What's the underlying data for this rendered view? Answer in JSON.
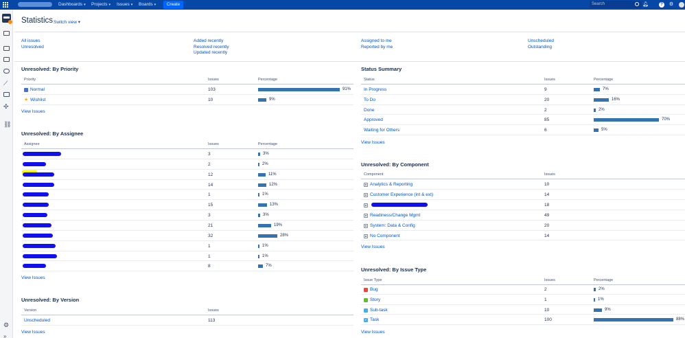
{
  "topbar": {
    "nav": [
      {
        "label": "Dashboards"
      },
      {
        "label": "Projects"
      },
      {
        "label": "Issues"
      },
      {
        "label": "Boards"
      }
    ],
    "create_label": "Create",
    "search_placeholder": "Search",
    "icons": [
      "app-switcher-icon",
      "search-icon",
      "notifications-icon",
      "help-icon",
      "settings-icon",
      "avatar"
    ]
  },
  "sidebar": {
    "icons": [
      "project-avatar",
      "backlog-icon",
      "board-icon",
      "releases-icon",
      "reports-icon",
      "issues-icon",
      "components-icon",
      "addons-icon",
      "link-icon",
      "settings-icon",
      "collapse-icon"
    ]
  },
  "page": {
    "title": "Statistics",
    "switch_view": "Switch view"
  },
  "filters": {
    "col1": [
      "All issues",
      "Unresolved"
    ],
    "col2": [
      "Added recently",
      "Resolved recently",
      "Updated recently"
    ],
    "col3": [
      "Assigned to me",
      "Reported by me"
    ],
    "col4": [
      "Unscheduled",
      "Outstanding"
    ]
  },
  "by_priority": {
    "title": "Unresolved: By Priority",
    "headers": {
      "name": "Priority",
      "issues": "Issues",
      "pct": "Percentage"
    },
    "rows": [
      {
        "name": "Normal",
        "issues": "103",
        "pct": "91%",
        "fraction": 0.91,
        "icon": "normal-priority-icon"
      },
      {
        "name": "Wishlist",
        "issues": "10",
        "pct": "9%",
        "fraction": 0.09,
        "icon": "wishlist-priority-icon"
      }
    ],
    "view": "View Issues"
  },
  "by_assignee": {
    "title": "Unresolved: By Assignee",
    "headers": {
      "name": "Assignee",
      "issues": "Issues",
      "pct": "Percentage"
    },
    "rows": [
      {
        "issues": "3",
        "pct": "3%",
        "fraction": 0.03
      },
      {
        "issues": "2",
        "pct": "2%",
        "fraction": 0.02
      },
      {
        "issues": "12",
        "pct": "11%",
        "fraction": 0.11
      },
      {
        "issues": "14",
        "pct": "12%",
        "fraction": 0.12
      },
      {
        "issues": "1",
        "pct": "1%",
        "fraction": 0.01
      },
      {
        "issues": "15",
        "pct": "13%",
        "fraction": 0.13
      },
      {
        "issues": "3",
        "pct": "3%",
        "fraction": 0.03
      },
      {
        "issues": "21",
        "pct": "19%",
        "fraction": 0.19
      },
      {
        "issues": "32",
        "pct": "28%",
        "fraction": 0.28
      },
      {
        "issues": "1",
        "pct": "1%",
        "fraction": 0.01
      },
      {
        "issues": "1",
        "pct": "1%",
        "fraction": 0.01
      },
      {
        "issues": "8",
        "pct": "7%",
        "fraction": 0.07
      }
    ],
    "view": "View Issues"
  },
  "by_version": {
    "title": "Unresolved: By Version",
    "headers": {
      "name": "Version",
      "issues": "Issues"
    },
    "rows": [
      {
        "name": "Unscheduled",
        "issues": "113"
      }
    ],
    "view": "View Issues"
  },
  "status_summary": {
    "title": "Status Summary",
    "headers": {
      "name": "Status",
      "issues": "Issues",
      "pct": "Percentage"
    },
    "rows": [
      {
        "name": "In Progress",
        "issues": "9",
        "pct": "7%",
        "fraction": 0.07
      },
      {
        "name": "To Do",
        "issues": "20",
        "pct": "16%",
        "fraction": 0.16
      },
      {
        "name": "Done",
        "issues": "2",
        "pct": "2%",
        "fraction": 0.02
      },
      {
        "name": "Approved",
        "issues": "85",
        "pct": "70%",
        "fraction": 0.7
      },
      {
        "name": "Waiting for Others",
        "issues": "6",
        "pct": "5%",
        "fraction": 0.05
      }
    ],
    "view": "View Issues"
  },
  "by_component": {
    "title": "Unresolved: By Component",
    "headers": {
      "name": "Component",
      "issues": "Issues"
    },
    "rows": [
      {
        "name": "Analytics & Reporting",
        "issues": "10"
      },
      {
        "name": "Customer Experience (int & ext)",
        "issues": "14"
      },
      {
        "name": "",
        "issues": "18",
        "redacted": true
      },
      {
        "name": "Readiness/Change Mgmt",
        "issues": "49"
      },
      {
        "name": "System: Data & Config",
        "issues": "20"
      },
      {
        "name": "No Component",
        "issues": "14"
      }
    ],
    "view": "View Issues"
  },
  "by_type": {
    "title": "Unresolved: By Issue Type",
    "headers": {
      "name": "Issue Type",
      "issues": "Issues",
      "pct": "Percentage"
    },
    "rows": [
      {
        "name": "Bug",
        "issues": "2",
        "pct": "2%",
        "fraction": 0.02,
        "icon": "bug-icon"
      },
      {
        "name": "Story",
        "issues": "1",
        "pct": "1%",
        "fraction": 0.01,
        "icon": "story-icon"
      },
      {
        "name": "Sub-task",
        "issues": "10",
        "pct": "9%",
        "fraction": 0.09,
        "icon": "subtask-icon"
      },
      {
        "name": "Task",
        "issues": "100",
        "pct": "88%",
        "fraction": 0.88,
        "icon": "task-icon"
      }
    ],
    "view": "View Issues"
  },
  "colors": {
    "topbar": "#0747a6",
    "link": "#0052cc",
    "bar": "#3572b0",
    "redaction": "#1010ee",
    "highlight": "#f5f50a"
  }
}
